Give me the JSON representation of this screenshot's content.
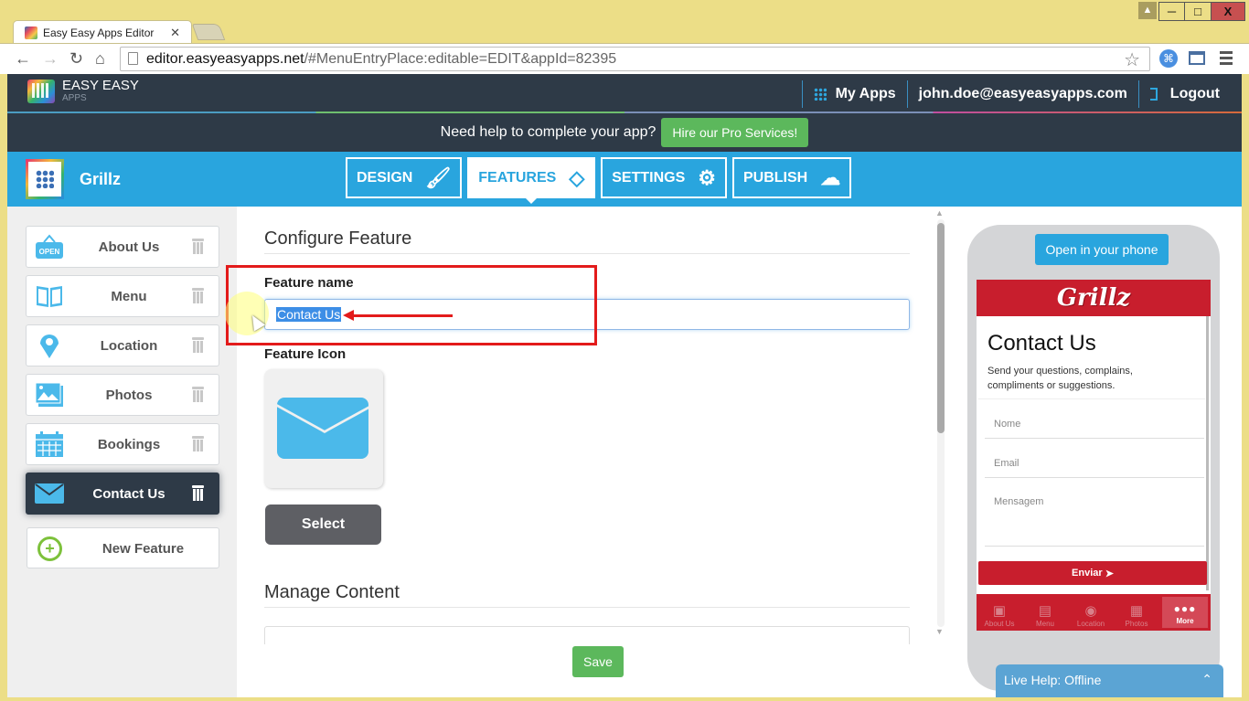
{
  "browser": {
    "tab_title": "Easy Easy Apps Editor",
    "url_host": "editor.easyeasyapps.net",
    "url_path": "/#MenuEntryPlace:editable=EDIT&appId=82395"
  },
  "header": {
    "logo_title": "EASY EASY",
    "logo_sub": "APPS",
    "my_apps": "My Apps",
    "user_email": "john.doe@easyeasyapps.com",
    "logout": "Logout"
  },
  "help_bar": {
    "text": "Need help to complete your app?",
    "cta": "Hire our Pro Services!"
  },
  "app": {
    "name": "Grillz",
    "tabs": [
      {
        "label": "DESIGN",
        "icon": "brush-icon",
        "active": false
      },
      {
        "label": "FEATURES",
        "icon": "tags-icon",
        "active": true
      },
      {
        "label": "SETTINGS",
        "icon": "gear-icon",
        "active": false
      },
      {
        "label": "PUBLISH",
        "icon": "cloud-upload-icon",
        "active": false
      }
    ]
  },
  "sidebar": {
    "items": [
      {
        "label": "About Us",
        "icon": "open-sign-icon"
      },
      {
        "label": "Menu",
        "icon": "book-icon"
      },
      {
        "label": "Location",
        "icon": "map-pin-icon"
      },
      {
        "label": "Photos",
        "icon": "photos-icon"
      },
      {
        "label": "Bookings",
        "icon": "calendar-icon"
      },
      {
        "label": "Contact Us",
        "icon": "envelope-icon",
        "active": true
      }
    ],
    "new_feature": "New Feature"
  },
  "configure": {
    "title": "Configure Feature",
    "name_label": "Feature name",
    "name_value": "Contact Us",
    "icon_label": "Feature Icon",
    "select_button": "Select",
    "manage_title": "Manage Content",
    "save_button": "Save"
  },
  "preview": {
    "open_button": "Open in your phone",
    "brand": "Grillz",
    "title": "Contact Us",
    "description": "Send your questions, complains, compliments or suggestions.",
    "fields": [
      "Nome",
      "Email",
      "Mensagem"
    ],
    "submit": "Enviar",
    "tabbar": [
      {
        "label": "About Us",
        "icon": "open-sign-icon"
      },
      {
        "label": "Menu",
        "icon": "book-icon"
      },
      {
        "label": "Location",
        "icon": "map-pin-icon"
      },
      {
        "label": "Photos",
        "icon": "photos-icon"
      },
      {
        "label": "More",
        "icon": "more-dots-icon",
        "active": true
      }
    ]
  },
  "live_help": "Live Help: Offline",
  "colors": {
    "brand_blue": "#29a5de",
    "dark_header": "#2e3a47",
    "success_green": "#5cb85c",
    "preview_red": "#c81e2d",
    "annotation_red": "#e31b1b"
  }
}
